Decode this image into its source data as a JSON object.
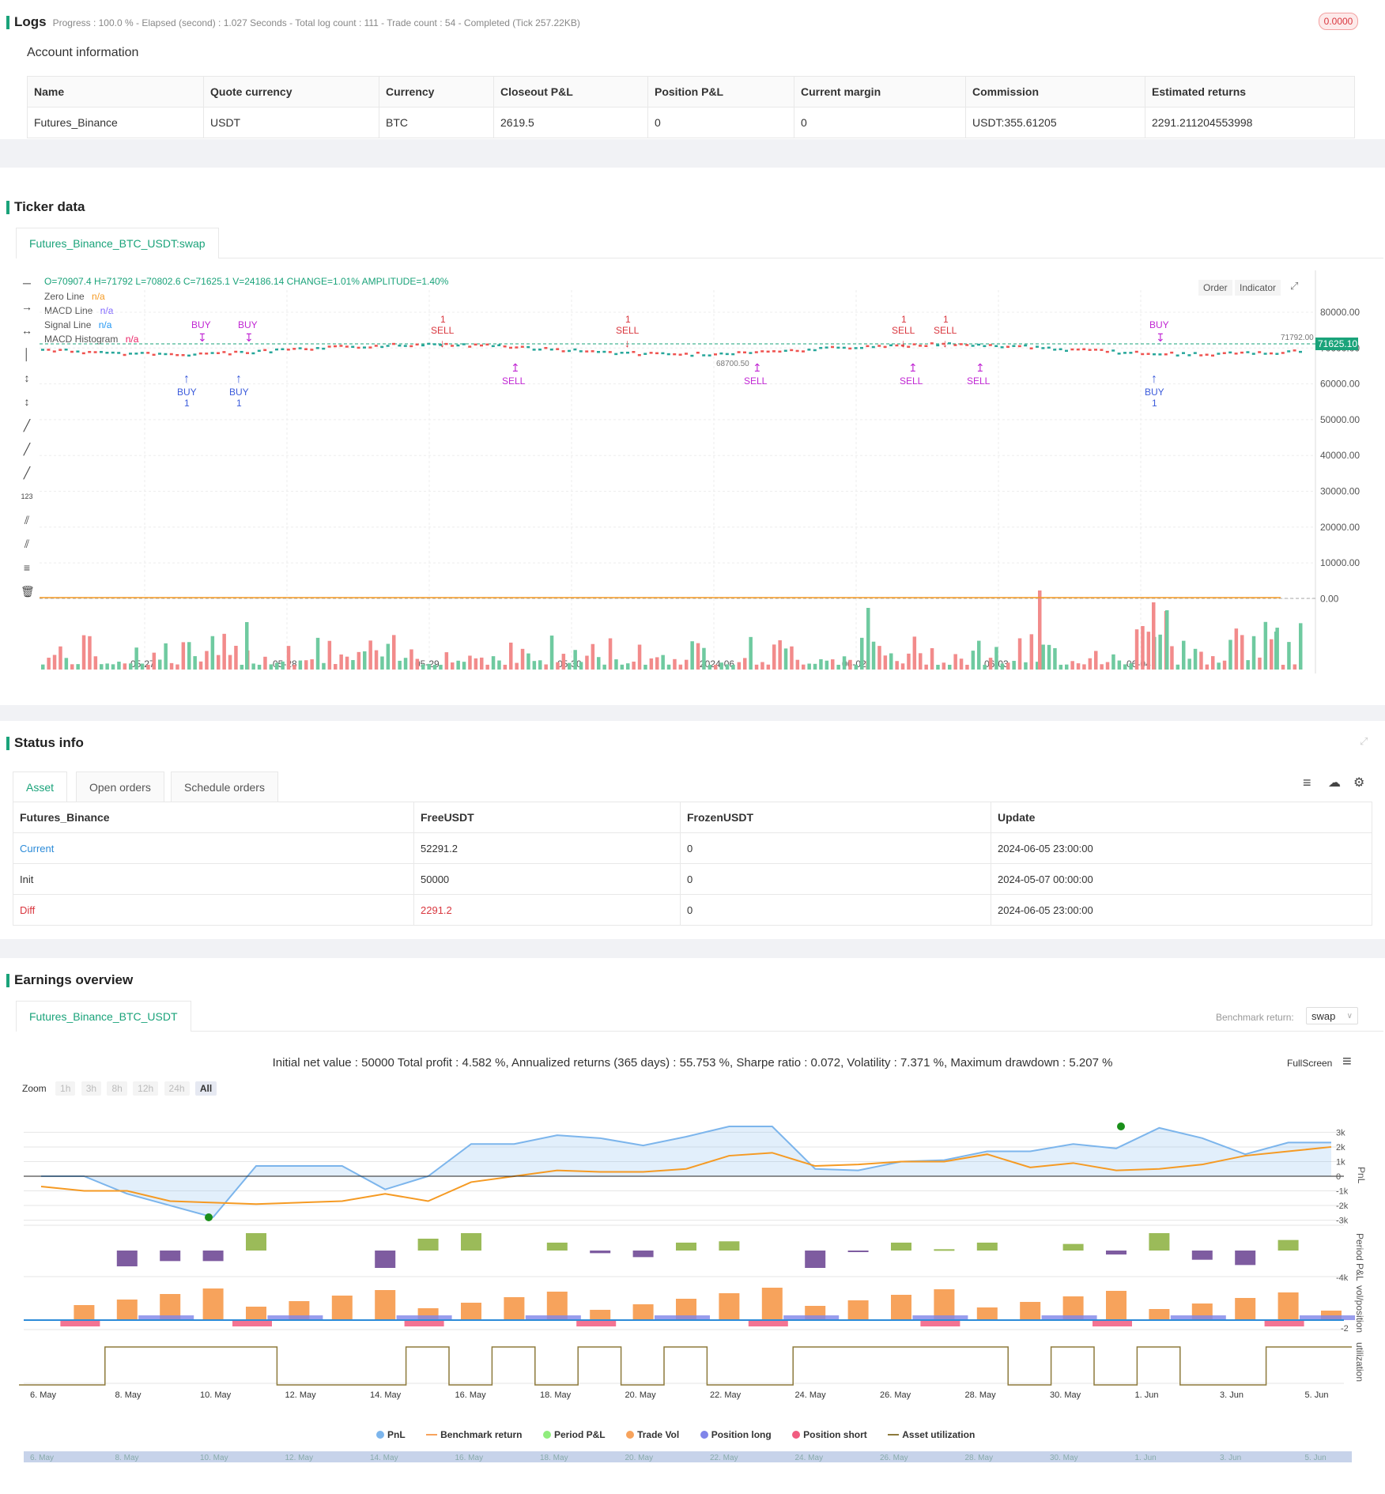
{
  "logs": {
    "title": "Logs",
    "progress": "Progress : 100.0 % - Elapsed (second) : 1.027  Seconds - Total log count : 111 - Trade count : 54 - Completed (Tick 257.22KB)",
    "badge": "0.0000"
  },
  "account": {
    "title": "Account information",
    "headers": [
      "Name",
      "Quote currency",
      "Currency",
      "Closeout P&L",
      "Position P&L",
      "Current margin",
      "Commission",
      "Estimated returns"
    ],
    "row": [
      "Futures_Binance",
      "USDT",
      "BTC",
      "2619.5",
      "0",
      "0",
      "USDT:355.61205",
      "2291.211204553998"
    ]
  },
  "ticker": {
    "title": "Ticker data",
    "tab": "Futures_Binance_BTC_USDT:swap",
    "ohlc": "O=70907.4 H=71792 L=70802.6 C=71625.1 V=24186.14 CHANGE=1.01% AMPLITUDE=1.40%",
    "legend": [
      {
        "name": "Zero Line",
        "value": "n/a",
        "color": "#f59a23"
      },
      {
        "name": "MACD Line",
        "value": "n/a",
        "color": "#7b61ff"
      },
      {
        "name": "Signal Line",
        "value": "n/a",
        "color": "#2196f3"
      },
      {
        "name": "MACD Histogram",
        "value": "n/a",
        "color": "#e91e63"
      }
    ],
    "buttons": [
      "Order",
      "Indicator"
    ],
    "price_tag": "71625.10",
    "high_label": "71792.00",
    "low_label": "68700.50",
    "y_ticks": [
      "80000.00",
      "70000.00",
      "60000.00",
      "50000.00",
      "40000.00",
      "30000.00",
      "20000.00",
      "10000.00",
      "0.00"
    ],
    "x_ticks": [
      "05-27",
      "05-28",
      "05-29",
      "05-30",
      "2024-06",
      "06-02",
      "06-03",
      "06-04"
    ],
    "signals": {
      "buy": "BUY",
      "sell": "SELL",
      "qty": "1"
    }
  },
  "status": {
    "title": "Status info",
    "tabs": [
      "Asset",
      "Open orders",
      "Schedule orders"
    ],
    "headers": [
      "Futures_Binance",
      "FreeUSDT",
      "FrozenUSDT",
      "Update"
    ],
    "rows": [
      [
        "Current",
        "52291.2",
        "0",
        "2024-06-05 23:00:00"
      ],
      [
        "Init",
        "50000",
        "0",
        "2024-05-07 00:00:00"
      ],
      [
        "Diff",
        "2291.2",
        "0",
        "2024-06-05 23:00:00"
      ]
    ]
  },
  "earnings": {
    "title": "Earnings overview",
    "tab": "Futures_Binance_BTC_USDT",
    "benchmark_label": "Benchmark return:",
    "benchmark_value": "swap",
    "summary": "Initial net value : 50000 Total profit : 4.582 %, Annualized returns (365 days) : 55.753 %, Sharpe ratio : 0.072, Volatility : 7.371 %, Maximum drawdown : 5.207 %",
    "fullscreen": "FullScreen",
    "zoom_label": "Zoom",
    "zoom_options": [
      "1h",
      "3h",
      "8h",
      "12h",
      "24h",
      "All"
    ],
    "pnl_ticks": [
      "3k",
      "2k",
      "1k",
      "0",
      "-1k",
      "-2k",
      "-3k"
    ],
    "period_tick": "-4k",
    "vol_tick": "-2",
    "axis_titles": [
      "PnL",
      "Period P&L",
      "vol/position",
      "utilization"
    ],
    "x_ticks": [
      "6. May",
      "8. May",
      "10. May",
      "12. May",
      "14. May",
      "16. May",
      "18. May",
      "20. May",
      "22. May",
      "24. May",
      "26. May",
      "28. May",
      "30. May",
      "1. Jun",
      "3. Jun",
      "5. Jun"
    ],
    "legend": [
      {
        "name": "PnL",
        "color": "#7cb5ec",
        "kind": "dot"
      },
      {
        "name": "Benchmark return",
        "color": "#f7a35c",
        "kind": "line"
      },
      {
        "name": "Period P&L",
        "color": "#90ed7d",
        "kind": "dot"
      },
      {
        "name": "Trade Vol",
        "color": "#f7a35c",
        "kind": "dot"
      },
      {
        "name": "Position long",
        "color": "#8085e9",
        "kind": "dot"
      },
      {
        "name": "Position short",
        "color": "#f15c80",
        "kind": "dot"
      },
      {
        "name": "Asset utilization",
        "color": "#8d7a3c",
        "kind": "line"
      }
    ]
  },
  "chart_data": {
    "type": "line",
    "x": [
      "6. May",
      "7. May",
      "8. May",
      "9. May",
      "10. May",
      "11. May",
      "12. May",
      "13. May",
      "14. May",
      "15. May",
      "16. May",
      "17. May",
      "18. May",
      "19. May",
      "20. May",
      "21. May",
      "22. May",
      "23. May",
      "24. May",
      "25. May",
      "26. May",
      "27. May",
      "28. May",
      "29. May",
      "30. May",
      "31. May",
      "1. Jun",
      "2. Jun",
      "3. Jun",
      "4. Jun",
      "5. Jun"
    ],
    "series": [
      {
        "name": "PnL",
        "values": [
          0,
          0,
          -1200,
          -2000,
          -2800,
          700,
          700,
          700,
          -900,
          0,
          2200,
          2200,
          2800,
          2600,
          2100,
          2700,
          3400,
          3400,
          500,
          400,
          1000,
          1100,
          1700,
          1700,
          2200,
          1900,
          3300,
          2600,
          1500,
          2300,
          2300
        ]
      },
      {
        "name": "Benchmark return",
        "values": [
          -700,
          -1000,
          -1000,
          -1700,
          -1800,
          -1900,
          -1800,
          -1700,
          -1200,
          -1700,
          -400,
          0,
          400,
          300,
          300,
          500,
          1400,
          1600,
          700,
          800,
          1000,
          1000,
          1500,
          600,
          900,
          400,
          500,
          800,
          1400,
          1700,
          2000
        ]
      }
    ],
    "ylim": [
      -3300,
      3500
    ]
  }
}
